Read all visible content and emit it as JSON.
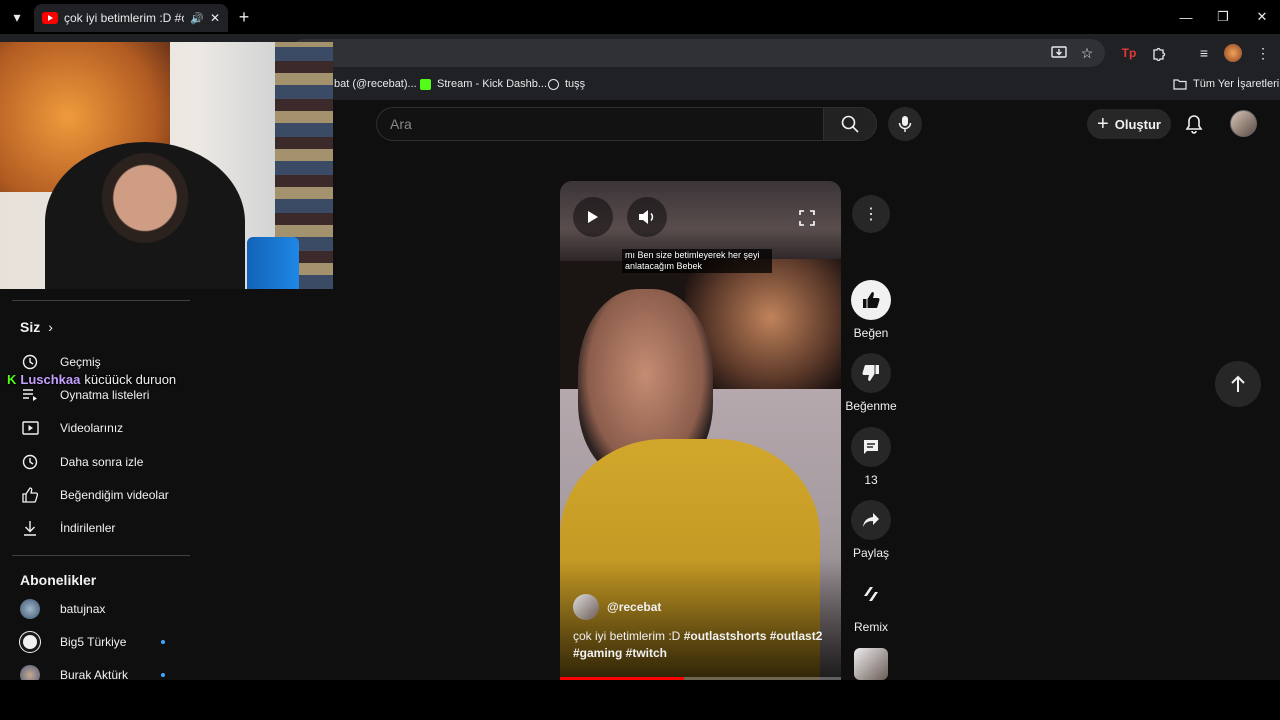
{
  "browser": {
    "tab_title": "çok iyi betimlerim :D #outla",
    "bookmarks": [
      {
        "label": "bat (@recebat)..."
      },
      {
        "label": "Stream - Kick Dashb..."
      },
      {
        "label": "tuşş"
      }
    ],
    "all_bookmarks": "Tüm Yer İşaretleri"
  },
  "youtube": {
    "search_placeholder": "Ara",
    "create_label": "Oluştur"
  },
  "sidebar": {
    "you_title": "Siz",
    "you_items": [
      {
        "label": "Geçmiş",
        "icon": "history-icon"
      },
      {
        "label": "Oynatma listeleri",
        "icon": "playlist-icon"
      },
      {
        "label": "Videolarınız",
        "icon": "video-icon"
      },
      {
        "label": "Daha sonra izle",
        "icon": "clock-icon"
      },
      {
        "label": "Beğendiğim videolar",
        "icon": "thumb-up-icon"
      },
      {
        "label": "İndirilenler",
        "icon": "download-icon"
      }
    ],
    "subs_title": "Abonelikler",
    "subscriptions": [
      {
        "name": "batujnax",
        "new": false
      },
      {
        "name": "Big5 Türkiye",
        "new": true
      },
      {
        "name": "Burak Aktürk",
        "new": true
      }
    ]
  },
  "chat": {
    "platform_badge": "K",
    "user": "Luschkaa",
    "message": "kücüück duruon"
  },
  "short": {
    "caption": "mı Ben size betimleyerek her şeyi anlatacağım Bebek",
    "channel": "@recebat",
    "title_text": "çok iyi betimlerim :D ",
    "title_tags": "#outlastshorts #outlast2 #gaming #twitch",
    "progress": 0.44
  },
  "actions": {
    "like": "Beğen",
    "dislike": "Beğenme",
    "comments": "13",
    "share": "Paylaş",
    "remix": "Remix"
  }
}
